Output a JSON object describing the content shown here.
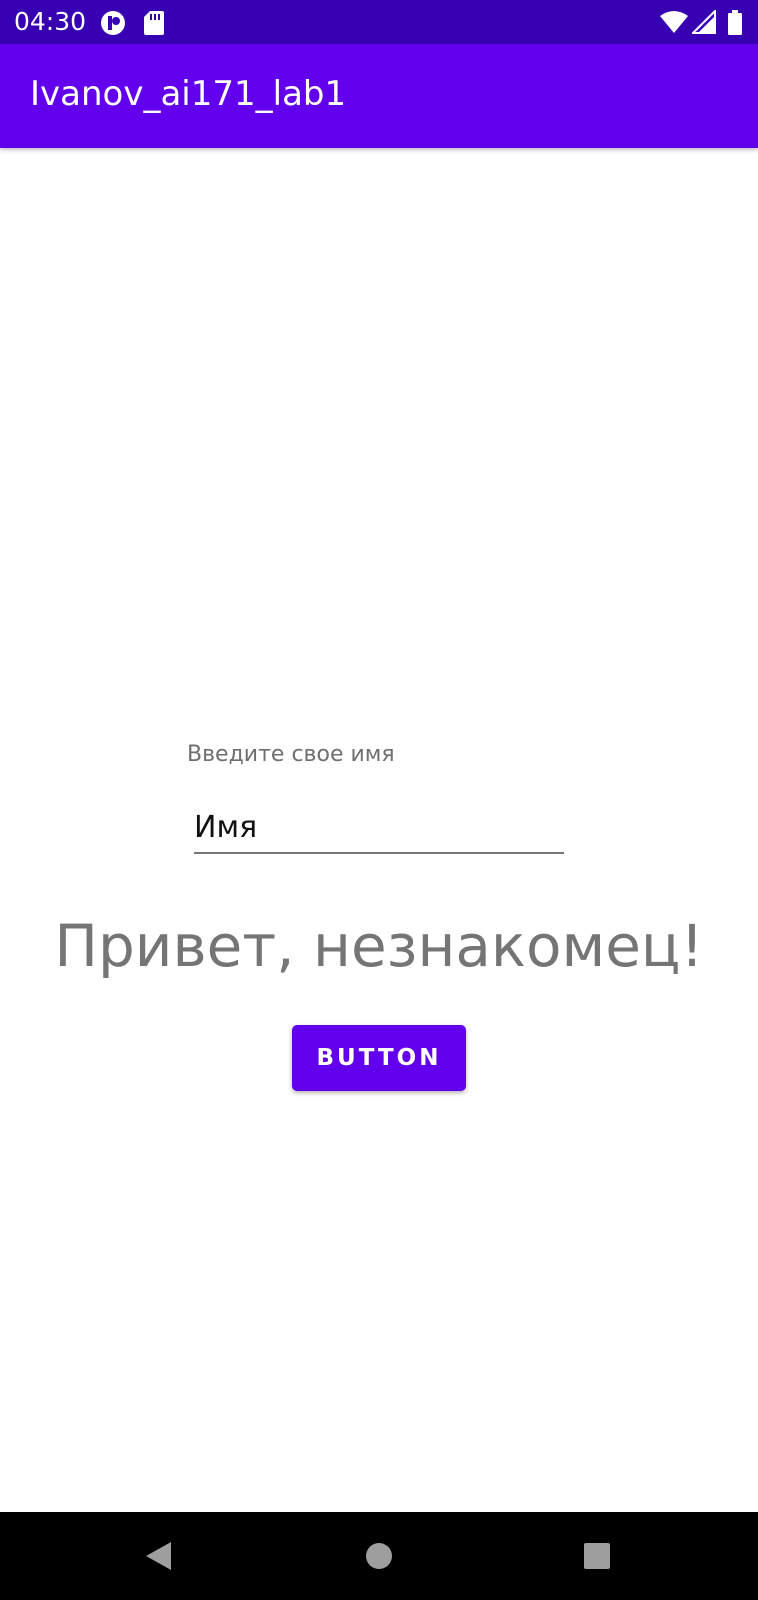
{
  "status_bar": {
    "time": "04:30",
    "background": "#3700B3",
    "left_icons": [
      "notification-app-icon",
      "sd-card-icon"
    ],
    "right_icons": [
      "wifi-icon",
      "cellular-signal-icon",
      "battery-icon"
    ]
  },
  "app_bar": {
    "title": "Ivanov_ai171_lab1",
    "background": "#6200EE"
  },
  "form": {
    "prompt_label": "Введите свое имя",
    "name_placeholder": "Имя",
    "name_value": ""
  },
  "greeting": {
    "text": "Привет, незнакомец!"
  },
  "button": {
    "label": "BUTTON",
    "color": "#6200EE"
  },
  "nav_bar": {
    "buttons": [
      "back-icon",
      "home-icon",
      "recents-icon"
    ]
  }
}
